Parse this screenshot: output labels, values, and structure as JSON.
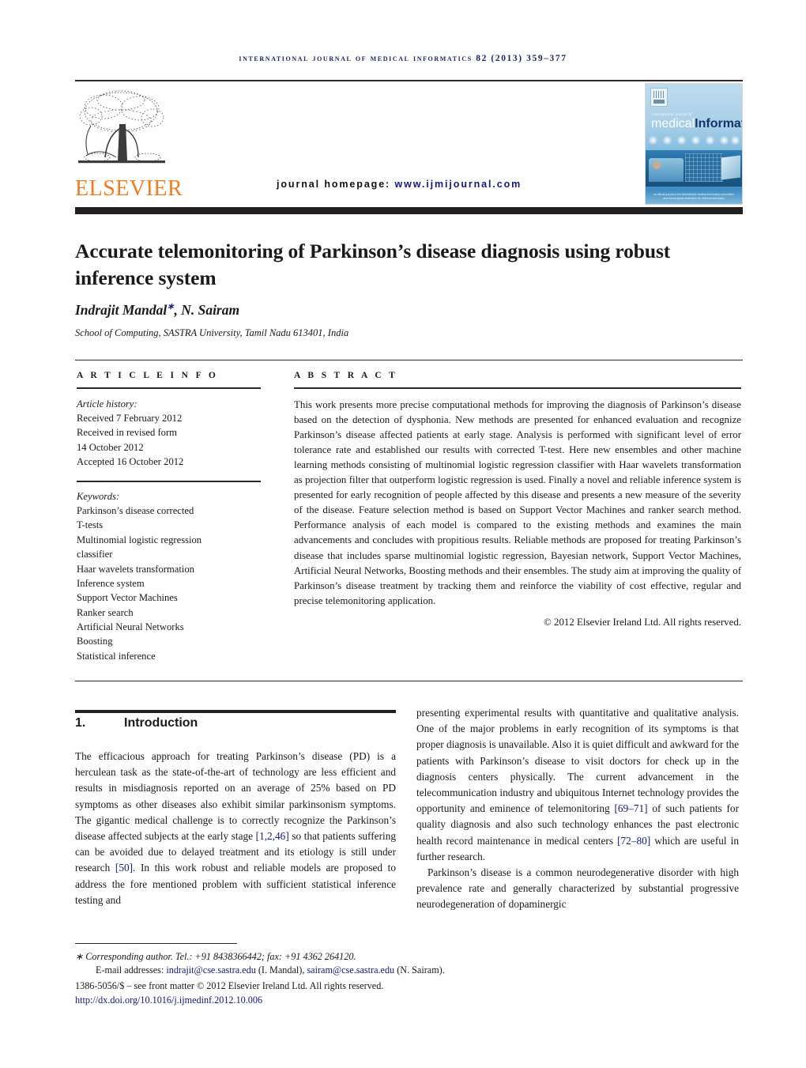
{
  "running_head": "International Journal of Medical Informatics 82 (2013) 359–377",
  "masthead": {
    "publisher_name": "ELSEVIER",
    "homepage_label": "journal homepage:",
    "homepage_url": "www.ijmijournal.com",
    "cover": {
      "kicker": "international journal of",
      "title_part1": "medical",
      "title_part2": "Informatics",
      "footer_line1": "an official journal of the international medical informatics association",
      "footer_line2": "and the european federation for medical informatics"
    }
  },
  "article": {
    "title": "Accurate telemonitoring of Parkinson’s disease diagnosis using robust inference system",
    "authors": "Indrajit Mandal",
    "authors_rest": ", N. Sairam",
    "corresponding_marker": "∗",
    "affiliation": "School of Computing, SASTRA University, Tamil Nadu 613401, India"
  },
  "info": {
    "section_label": "A R T I C L E   I N F O",
    "history_title": "Article history:",
    "history_lines": [
      "Received 7 February 2012",
      "Received in revised form",
      "14 October 2012",
      "Accepted 16 October 2012"
    ],
    "keywords_title": "Keywords:",
    "keywords": [
      "Parkinson’s disease corrected",
      "T-tests",
      "Multinomial logistic regression",
      "classifier",
      "Haar wavelets transformation",
      "Inference system",
      "Support Vector Machines",
      "Ranker search",
      "Artificial Neural Networks",
      "Boosting",
      "Statistical inference"
    ]
  },
  "abstract": {
    "section_label": "A B S T R A C T",
    "text": "This work presents more precise computational methods for improving the diagnosis of Parkinson’s disease based on the detection of dysphonia. New methods are presented for enhanced evaluation and recognize Parkinson’s disease affected patients at early stage. Analysis is performed with significant level of error tolerance rate and established our results with corrected T-test. Here new ensembles and other machine learning methods consisting of multinomial logistic regression classifier with Haar wavelets transformation as projection filter that outperform logistic regression is used. Finally a novel and reliable inference system is presented for early recognition of people affected by this disease and presents a new measure of the severity of the disease. Feature selection method is based on Support Vector Machines and ranker search method. Performance analysis of each model is compared to the existing methods and examines the main advancements and concludes with propitious results. Reliable methods are proposed for treating Parkinson’s disease that includes sparse multinomial logistic regression, Bayesian network, Support Vector Machines, Artificial Neural Networks, Boosting methods and their ensembles. The study aim at improving the quality of Parkinson’s disease treatment by tracking them and reinforce the viability of cost effective, regular and precise telemonitoring application.",
    "copyright": "© 2012 Elsevier Ireland Ltd. All rights reserved."
  },
  "body": {
    "section_number": "1.",
    "section_title": "Introduction",
    "left_paragraph_pre": "The efficacious approach for treating Parkinson’s disease (PD) is a herculean task as the state-of-the-art of technology are less efficient and results in misdiagnosis reported on an average of 25% based on PD symptoms as other diseases also exhibit similar parkinsonism symptoms. The gigantic medical challenge is to correctly recognize the Parkinson’s disease affected subjects at the early stage ",
    "left_ref_1": "[1,2,46]",
    "left_paragraph_mid": " so that patients suffering can be avoided due to delayed treatment and its etiology is still under research ",
    "left_ref_2": "[50]",
    "left_paragraph_post": ". In this work robust and reliable models are proposed to address the fore mentioned problem with sufficient statistical inference testing and",
    "right_paragraph_pre": "presenting experimental results with quantitative and qualitative analysis. One of the major problems in early recognition of its symptoms is that proper diagnosis is unavailable. Also it is quiet difficult and awkward for the patients with Parkinson’s disease to visit doctors for check up in the diagnosis centers physically. The current advancement in the telecommunication industry and ubiquitous Internet technology provides the opportunity and eminence of telemonitoring ",
    "right_ref_1": "[69–71]",
    "right_paragraph_mid": " of such patients for quality diagnosis and also such technology enhances the past electronic health record maintenance in medical centers ",
    "right_ref_2": "[72–80]",
    "right_paragraph_post": " which are useful in further research.",
    "right_paragraph_2": "Parkinson’s disease is a common neurodegenerative disorder with high prevalence rate and generally characterized by substantial progressive neurodegeneration of dopaminergic"
  },
  "footnote": {
    "marker": "∗",
    "corresponding_text": "Corresponding author. Tel.: +91 8438366442; fax: +91 4362 264120.",
    "email_label": "E-mail addresses:",
    "email_1": "indrajit@cse.sastra.edu",
    "email_1_name": "(I. Mandal),",
    "email_2": "sairam@cse.sastra.edu",
    "email_2_name": "(N. Sairam).",
    "issn_line": "1386-5056/$ – see front matter © 2012 Elsevier Ireland Ltd. All rights reserved.",
    "doi": "http://dx.doi.org/10.1016/j.ijmedinf.2012.10.006"
  }
}
